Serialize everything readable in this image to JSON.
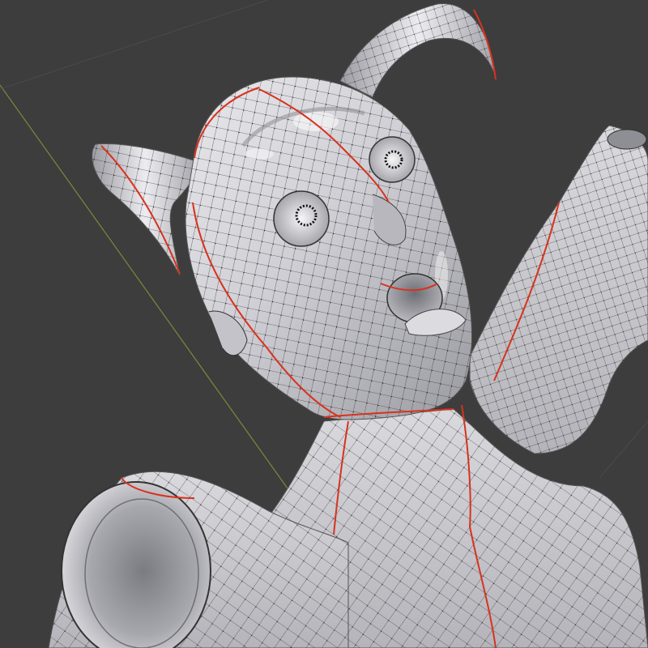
{
  "viewport": {
    "view": "3d-viewport",
    "object": "sculpted-character-mesh",
    "overlay": "wireframe-with-seams",
    "colors": {
      "background": "#3d3d3d",
      "grid_line": "#7a8a3a",
      "mesh_light": "#f2f2f4",
      "mesh_mid": "#c9c9cf",
      "mesh_dark": "#8b8b92",
      "wire": "#262626",
      "vertex": "#111111",
      "seam": "#d8321e"
    }
  }
}
